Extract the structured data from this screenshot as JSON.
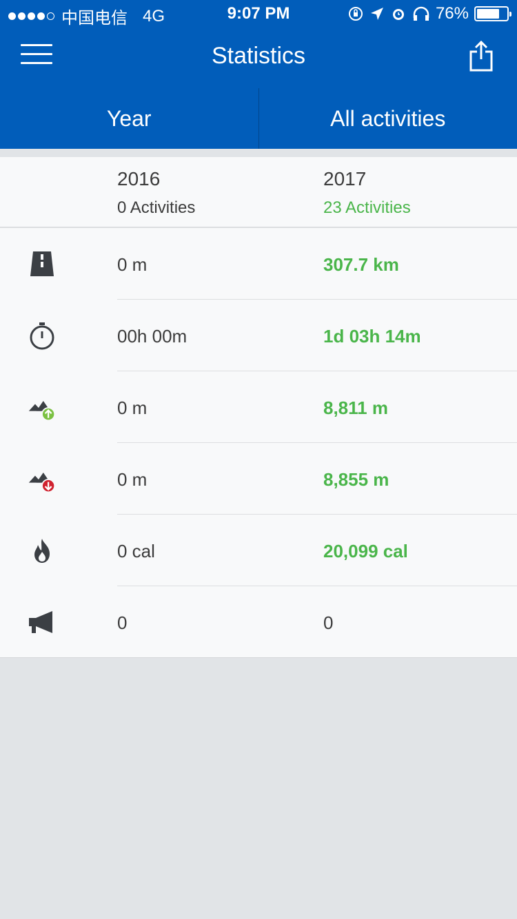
{
  "status_bar": {
    "carrier": "中国电信",
    "network": "4G",
    "time": "9:07 PM",
    "battery_percent": "76%",
    "battery_level": 0.76
  },
  "nav": {
    "title": "Statistics"
  },
  "segments": {
    "period": "Year",
    "activity_filter": "All activities"
  },
  "columns": [
    {
      "year": "2016",
      "activities": "0 Activities"
    },
    {
      "year": "2017",
      "activities": "23 Activities"
    }
  ],
  "rows": [
    {
      "icon": "road-icon",
      "v2016": "0 m",
      "v2017": "307.7 km"
    },
    {
      "icon": "stopwatch-icon",
      "v2016": "00h 00m",
      "v2017": "1d 03h 14m"
    },
    {
      "icon": "elevation-gain-icon",
      "v2016": "0 m",
      "v2017": "8,811 m"
    },
    {
      "icon": "elevation-loss-icon",
      "v2016": "0 m",
      "v2017": "8,855 m"
    },
    {
      "icon": "calories-flame-icon",
      "v2016": "0 cal",
      "v2017": "20,099 cal"
    },
    {
      "icon": "megaphone-icon",
      "v2016": "0",
      "v2017": "0"
    }
  ],
  "colors": {
    "header_blue": "#015dba",
    "highlight_green": "#4ab54a",
    "text_dark": "#3b3b3b",
    "up_badge": "#7bc142",
    "down_badge": "#d0222f"
  }
}
